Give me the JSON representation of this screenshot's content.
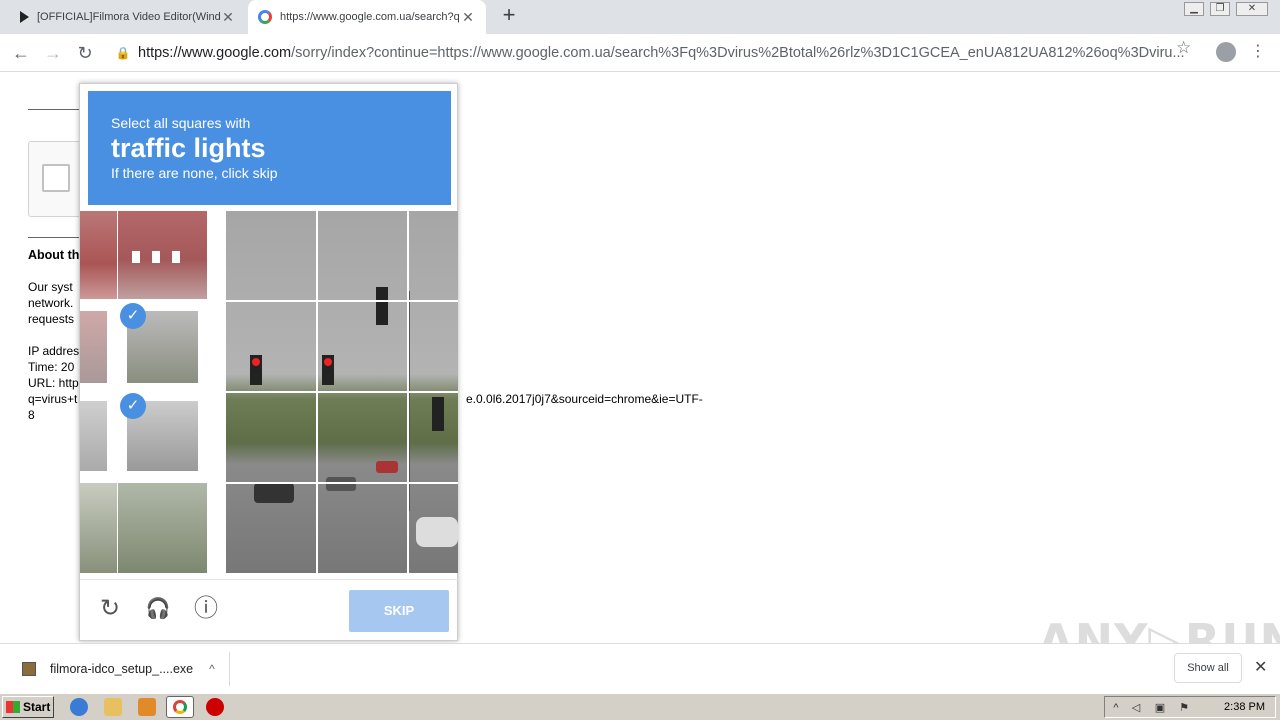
{
  "tabs": [
    {
      "title": "[OFFICIAL]Filmora Video Editor(Windows)",
      "active": false
    },
    {
      "title": "https://www.google.com.ua/search?q=virus",
      "active": true
    }
  ],
  "icons": {
    "tab1_favicon": "filmora-icon",
    "tab2_favicon": "google-icon",
    "new_tab": "+",
    "back": "←",
    "forward": "→",
    "reload": "↻",
    "lock": "🔒",
    "star": "☆",
    "menu": "⋮",
    "tab_close": "✕",
    "win_minimize": "▁",
    "win_restore": "❐",
    "win_close": "✕"
  },
  "omnibox": {
    "host": "https://www.google.com",
    "path": "/sorry/index?continue=https://www.google.com.ua/search%3Fq%3Dvirus%2Btotal%26rlz%3D1C1GCEA_enUA812UA812%26oq%3Dviru..."
  },
  "page": {
    "about_heading": "About th",
    "lines": [
      "Our syst",
      "network.",
      "requests",
      "",
      "IP addres",
      "Time: 20",
      "URL: http",
      "q=virus+t",
      "8"
    ],
    "url_tail": "e.0.0l6.2017j0j7&sourceid=chrome&ie=UTF-"
  },
  "captcha": {
    "line1": "Select all squares with",
    "target": "traffic lights",
    "line3": "If there are none, click skip",
    "check_glyph": "✓",
    "reload_glyph": "↻",
    "audio_glyph": "🎧",
    "info_glyph": "ⓘ",
    "skip_label": "SKIP",
    "accent_color": "#4a90e2"
  },
  "downloads": {
    "file_name": "filmora-idco_setup_....exe",
    "chevron": "^",
    "show_all": "Show all",
    "close": "✕"
  },
  "watermark": "ANY▷RUN",
  "taskbar": {
    "start_label": "Start",
    "clock": "2:38 PM"
  }
}
